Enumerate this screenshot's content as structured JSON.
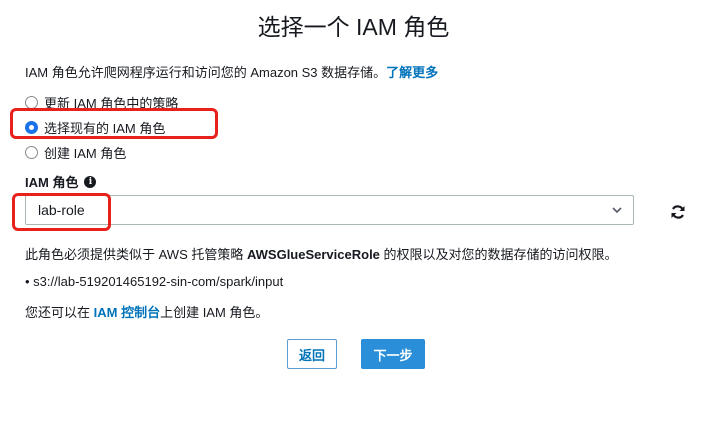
{
  "dialog": {
    "title": "选择一个 IAM 角色"
  },
  "intro": {
    "text": "IAM 角色允许爬网程序运行和访问您的 Amazon S3 数据存储。",
    "link": "了解更多"
  },
  "radio_options": [
    {
      "label": "更新 IAM 角色中的策略",
      "checked": false
    },
    {
      "label": "选择现有的 IAM 角色",
      "checked": true
    },
    {
      "label": "创建 IAM 角色",
      "checked": false
    }
  ],
  "iam_role": {
    "label": "IAM 角色",
    "info_icon": "info-icon",
    "selected_value": "lab-role",
    "refresh_icon": "refresh-icon"
  },
  "note": {
    "prefix": "此角色必须提供类似于 AWS 托管策略 ",
    "policy": "AWSGlueServiceRole",
    "suffix": " 的权限以及对您的数据存储的访问权限。"
  },
  "bullet": "• s3://lab-519201465192-sin-com/spark/input",
  "footer_note": {
    "prefix": "您还可以在 ",
    "link": "IAM 控制台",
    "suffix": "上创建 IAM 角色。"
  },
  "buttons": {
    "back": "返回",
    "next": "下一步"
  },
  "colors": {
    "link": "#0073bb",
    "primary_button": "#2a8fd8",
    "highlight": "#e8211c"
  }
}
